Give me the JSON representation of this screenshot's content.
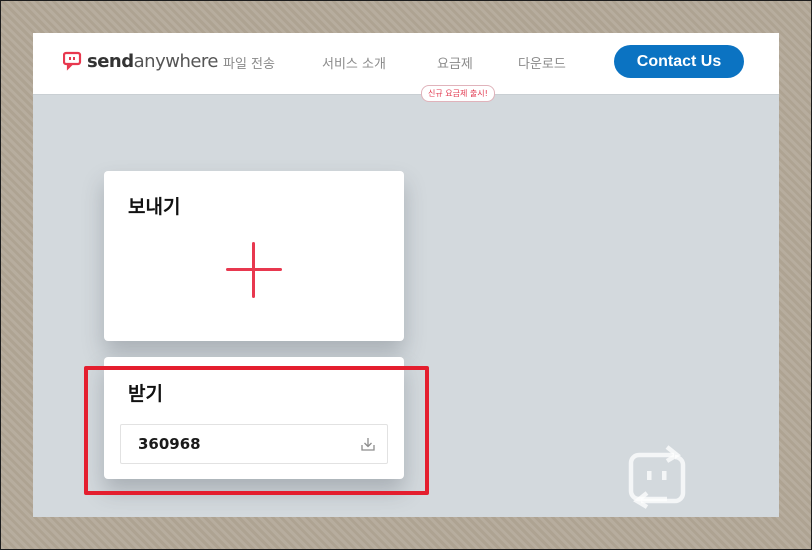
{
  "header": {
    "logo": {
      "send": "send",
      "anywhere": "anywhere"
    },
    "nav": {
      "file_transfer": "파일 전송",
      "service_intro": "서비스 소개",
      "pricing": "요금제",
      "download": "다운로드"
    },
    "pricing_badge": "신규 요금제 출시!",
    "contact_button": "Contact Us"
  },
  "send_card": {
    "title": "보내기",
    "add_icon": "plus-icon"
  },
  "receive_card": {
    "title": "받기",
    "key_value": "360968",
    "download_icon": "download-icon"
  },
  "colors": {
    "brand_red": "#e8384f",
    "primary_blue": "#0b73c2",
    "highlight_red": "#e41e2e",
    "background": "#d3d9dd"
  }
}
